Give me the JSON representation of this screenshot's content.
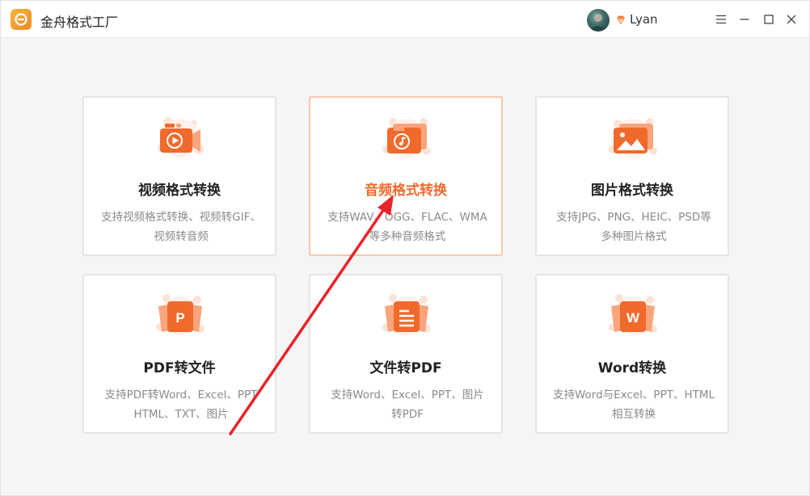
{
  "app": {
    "title": "金舟格式工厂",
    "user_name": "Lyan"
  },
  "colors": {
    "accent": "#f06a2c",
    "accent_light": "#f8a47c",
    "arrow": "#e8232a"
  },
  "cards": [
    {
      "title": "视频格式转换",
      "desc_line1": "支持视频格式转换、视频转GIF、",
      "desc_line2": "视频转音频",
      "icon": "video-play-icon"
    },
    {
      "title": "音频格式转换",
      "desc_line1": "支持WAV、OGG、FLAC、WMA",
      "desc_line2": "等多种音频格式",
      "icon": "music-note-icon"
    },
    {
      "title": "图片格式转换",
      "desc_line1": "支持JPG、PNG、HEIC、PSD等",
      "desc_line2": "多种图片格式",
      "icon": "image-icon"
    },
    {
      "title": "PDF转文件",
      "desc_line1": "支持PDF转Word、Excel、PPT",
      "desc_line2": "HTML、TXT、图片",
      "icon": "pdf-p-icon",
      "icon_letter": "P"
    },
    {
      "title": "文件转PDF",
      "desc_line1": "支持Word、Excel、PPT、图片",
      "desc_line2": "转PDF",
      "icon": "document-lines-icon"
    },
    {
      "title": "Word转换",
      "desc_line1": "支持Word与Excel、PPT、HTML",
      "desc_line2": "相互转换",
      "icon": "word-w-icon",
      "icon_letter": "W"
    }
  ]
}
